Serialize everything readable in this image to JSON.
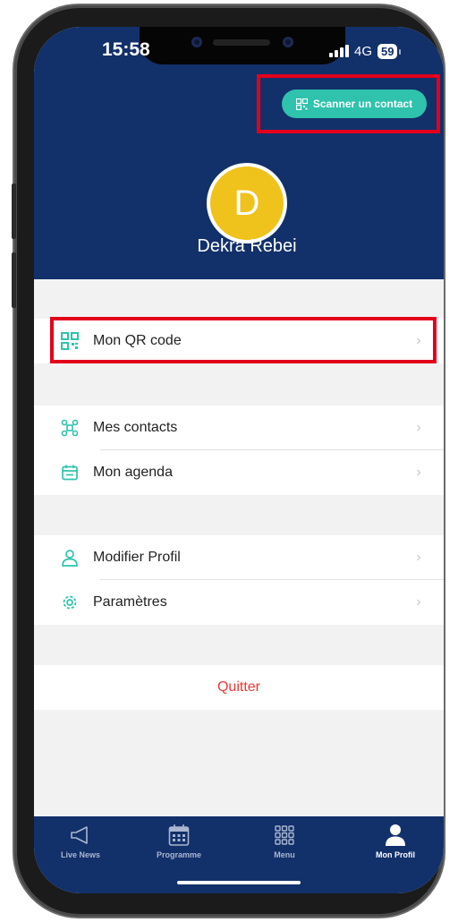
{
  "status_bar": {
    "time": "15:58",
    "network": "4G",
    "battery": "59"
  },
  "header": {
    "scan_button_label": "Scanner un contact",
    "avatar_initial": "D",
    "user_name": "Dekra Rebei"
  },
  "menu": {
    "qr_code": "Mon QR code",
    "contacts": "Mes contacts",
    "agenda": "Mon agenda",
    "edit_profile": "Modifier Profil",
    "settings": "Paramètres",
    "quit": "Quitter"
  },
  "tabs": [
    {
      "label": "Live News",
      "icon": "megaphone-icon"
    },
    {
      "label": "Programme",
      "icon": "calendar-icon"
    },
    {
      "label": "Menu",
      "icon": "grid-icon"
    },
    {
      "label": "Mon Profil",
      "icon": "person-icon"
    }
  ],
  "colors": {
    "primary": "#12306a",
    "accent": "#2fc2ad",
    "avatar": "#f0c21c",
    "danger": "#e53935",
    "highlight": "#e3001b"
  }
}
